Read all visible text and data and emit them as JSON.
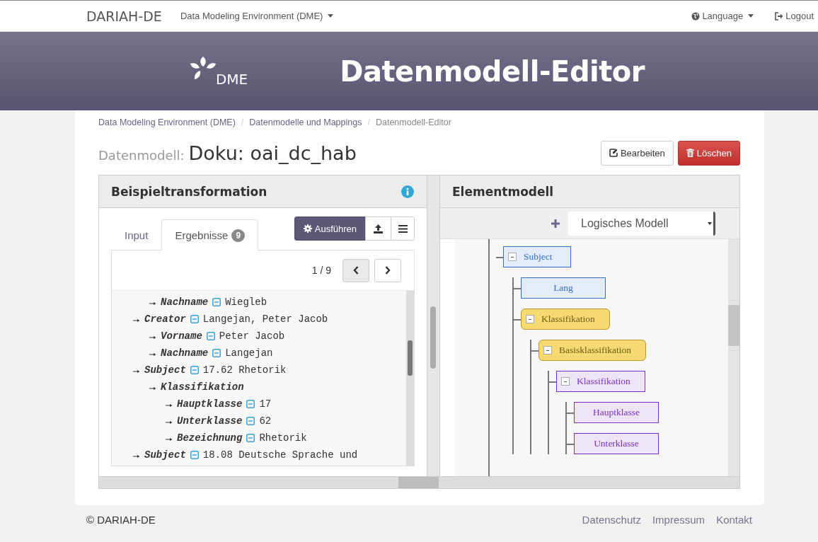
{
  "navbar": {
    "brand": "DARIAH-DE",
    "menu": "Data Modeling Environment (DME)",
    "language": "Language",
    "logout": "Logout"
  },
  "header": {
    "logo_text": "DME",
    "title": "Datenmodell-Editor"
  },
  "breadcrumb_separator": "/",
  "breadcrumb": [
    "Data Modeling Environment (DME)",
    "Datenmodelle und Mappings",
    "Datenmodell-Editor"
  ],
  "page_title": {
    "label": "Datenmodell:",
    "name": "Doku: oai_dc_hab"
  },
  "actions": [
    {
      "kind": "edit",
      "label": "Bearbeiten"
    },
    {
      "kind": "delete",
      "label": "Löschen"
    }
  ],
  "left_panel": {
    "title": "Beispieltransformation",
    "tabs": [
      {
        "label": "Input",
        "selected": false
      },
      {
        "label": "Ergebnisse",
        "count": "9",
        "selected": true
      }
    ],
    "run_button": "Ausführen",
    "pager": "1 / 9",
    "results": [
      {
        "name": "Nachname",
        "value": "Wiegleb",
        "indent": true
      },
      {
        "name": "Creator",
        "value": "Langejan, Peter Jacob",
        "children": [
          {
            "name": "Vorname",
            "value": "Peter Jacob"
          },
          {
            "name": "Nachname",
            "value": "Langejan"
          }
        ]
      },
      {
        "name": "Subject",
        "value": "17.62 Rhetorik",
        "children": [
          {
            "name": "Klassifikation",
            "children": [
              {
                "name": "Hauptklasse",
                "value": "17"
              },
              {
                "name": "Unterklasse",
                "value": "62"
              },
              {
                "name": "Bezeichnung",
                "value": "Rhetorik"
              }
            ]
          }
        ]
      },
      {
        "name": "Subject",
        "value": "18.08 Deutsche Sprache und"
      }
    ]
  },
  "right_panel": {
    "title": "Elementmodell",
    "model_select": "Logisches Modell",
    "tree": [
      {
        "label": "Subject",
        "kind": "element",
        "color": "#2f6fd0",
        "children": [
          {
            "label": "Lang",
            "kind": "element",
            "color": "#2f6fd0"
          },
          {
            "label": "Klassifikation",
            "kind": "container",
            "color": "#b8962a",
            "children": [
              {
                "label": "Basisklassifikation",
                "kind": "container",
                "color": "#b8962a",
                "children": [
                  {
                    "label": "Klassifikation",
                    "kind": "element",
                    "color": "#7a2fc8",
                    "children": [
                      {
                        "label": "Hauptklasse",
                        "kind": "element",
                        "color": "#7a2fc8"
                      },
                      {
                        "label": "Unterklasse",
                        "kind": "element",
                        "color": "#7a2fc8"
                      }
                    ]
                  }
                ]
              }
            ]
          }
        ]
      }
    ]
  },
  "footer": {
    "copyright": "© DARIAH-DE",
    "links": [
      "Datenschutz",
      "Impressum",
      "Kontakt"
    ]
  }
}
